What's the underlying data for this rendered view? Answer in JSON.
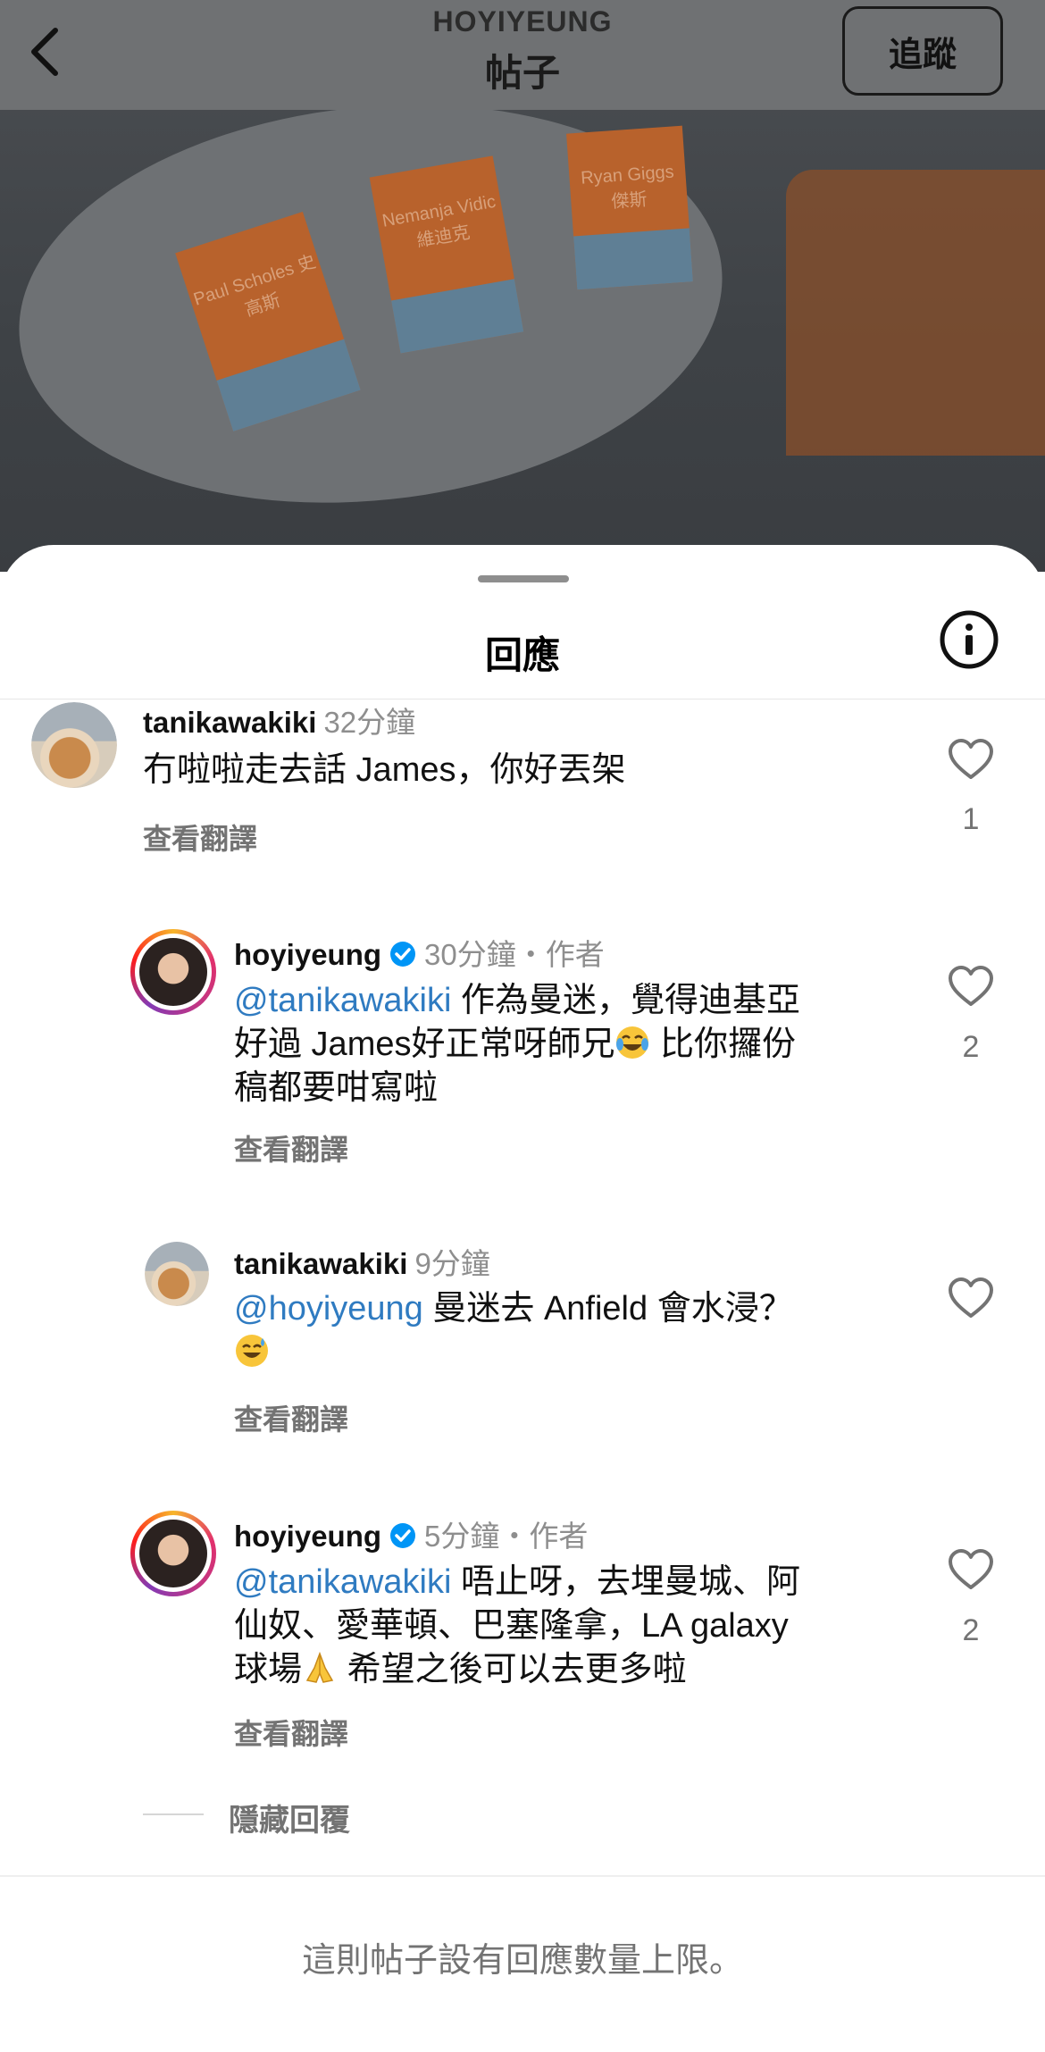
{
  "header": {
    "username": "HOYIYEUNG",
    "title": "帖子",
    "follow_label": "追蹤"
  },
  "photo": {
    "cards": [
      "Paul Scholes 史高斯",
      "Nemanja Vidic 維迪克",
      "Ryan Giggs 傑斯"
    ]
  },
  "sheet": {
    "title": "回應"
  },
  "comments": [
    {
      "username": "tanikawakiki",
      "time": "32分鐘",
      "text": "冇啦啦走去話 James，你好丟架",
      "translate": "查看翻譯",
      "likes": "1"
    },
    {
      "username": "hoyiyeung",
      "time": "30分鐘",
      "author": "・作者",
      "mention": "@tanikawakiki",
      "text1": " 作為曼迷，覺得迪基亞",
      "text2": "好過 James好正常呀師兄",
      "text3": " 比你攞份",
      "text4": "稿都要咁寫啦",
      "emoji": "face-with-tears-of-joy",
      "translate": "查看翻譯",
      "likes": "2"
    },
    {
      "username": "tanikawakiki",
      "time": "9分鐘",
      "mention": "@hoyiyeung",
      "text1": " 曼迷去 Anfield 會水浸？",
      "emoji": "grinning-face-with-sweat",
      "translate": "查看翻譯"
    },
    {
      "username": "hoyiyeung",
      "time": "5分鐘",
      "author": "・作者",
      "mention": "@tanikawakiki",
      "text1": " 唔止呀，去埋曼城、阿",
      "text2": "仙奴、愛華頓、巴塞隆拿，LA galaxy",
      "text3": "球場",
      "text4": " 希望之後可以去更多啦",
      "emoji": "folded-hands",
      "translate": "查看翻譯",
      "likes": "2"
    }
  ],
  "hide_replies": "隱藏回覆",
  "footer_note": "這則帖子設有回應數量上限。",
  "icons": [
    "back-icon",
    "info-icon",
    "heart-icon",
    "verified-badge-icon"
  ],
  "colors": {
    "mention": "#2f7bc1",
    "verified": "#0095f6",
    "muted": "#737373"
  }
}
